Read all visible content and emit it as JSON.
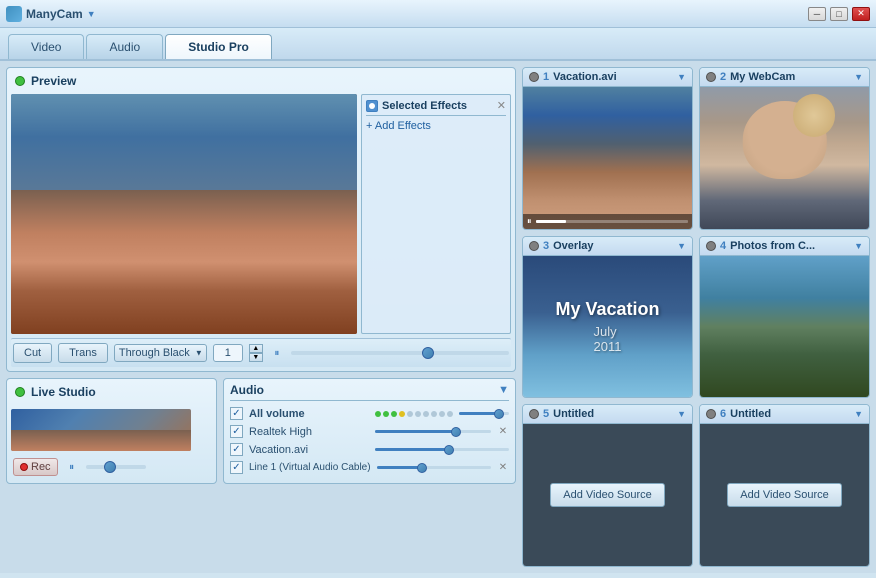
{
  "app": {
    "title": "ManyCam",
    "title_arrow": "▼"
  },
  "window_controls": {
    "minimize": "─",
    "maximize": "□",
    "close": "✕"
  },
  "tabs": [
    {
      "id": "video",
      "label": "Video",
      "active": false
    },
    {
      "id": "audio",
      "label": "Audio",
      "active": false
    },
    {
      "id": "studio",
      "label": "Studio Pro",
      "active": true
    }
  ],
  "preview": {
    "title": "Preview",
    "effects": {
      "title": "Selected Effects",
      "close": "✕",
      "add_label": "+ Add Effects"
    },
    "controls": {
      "cut_label": "Cut",
      "trans_label": "Trans",
      "through_black_label": "Through Black",
      "number_value": "1",
      "pause_icon": "⏸"
    }
  },
  "live_studio": {
    "title": "Live Studio",
    "rec_label": "Rec",
    "pause_icon": "⏸"
  },
  "audio": {
    "title": "Audio",
    "expand_icon": "▼",
    "rows": [
      {
        "id": "all-volume",
        "label": "All volume",
        "checked": true,
        "has_dots": true,
        "slider_pct": 80,
        "has_mute": false
      },
      {
        "id": "realtek",
        "label": "Realtek High",
        "checked": true,
        "has_dots": false,
        "slider_pct": 70,
        "has_mute": true
      },
      {
        "id": "vacation",
        "label": "Vacation.avi",
        "checked": true,
        "has_dots": false,
        "slider_pct": 55,
        "has_mute": false
      },
      {
        "id": "line1",
        "label": "Line 1 (Virtual Audio Cable)",
        "checked": true,
        "has_dots": false,
        "slider_pct": 40,
        "has_mute": true
      }
    ]
  },
  "video_slots": [
    {
      "id": 1,
      "number": "1",
      "title": "Vacation.avi",
      "type": "vacation",
      "has_playback": true
    },
    {
      "id": 2,
      "number": "2",
      "title": "My WebCam",
      "type": "webcam",
      "has_playback": false
    },
    {
      "id": 3,
      "number": "3",
      "title": "Overlay",
      "type": "overlay",
      "has_playback": false,
      "overlay_line1": "My Vacation",
      "overlay_line2": "July",
      "overlay_line3": "2011"
    },
    {
      "id": 4,
      "number": "4",
      "title": "Photos from C...",
      "type": "photos",
      "has_playback": false
    },
    {
      "id": 5,
      "number": "5",
      "title": "Untitled",
      "type": "empty",
      "add_label": "Add Video Source"
    },
    {
      "id": 6,
      "number": "6",
      "title": "Untitled",
      "type": "empty",
      "add_label": "Add Video Source"
    }
  ]
}
